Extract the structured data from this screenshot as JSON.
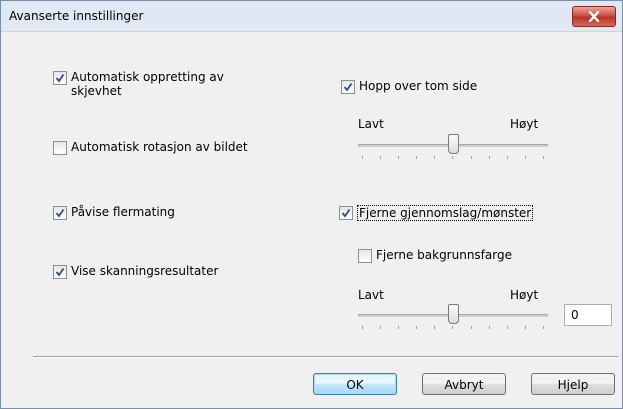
{
  "window": {
    "title": "Avanserte innstillinger"
  },
  "left": {
    "auto_deskew": {
      "label": "Automatisk oppretting av\nskjevhet",
      "line1": "Automatisk oppretting av",
      "line2": "skjevhet",
      "checked": true
    },
    "auto_rotate": {
      "label": "Automatisk rotasjon av bildet",
      "checked": false
    },
    "multifeed": {
      "label": "Påvise flermating",
      "checked": true
    },
    "show_results": {
      "label": "Vise skanningsresultater",
      "checked": true
    }
  },
  "right": {
    "skip_blank": {
      "label": "Hopp over tom side",
      "checked": true
    },
    "blank_slider": {
      "low": "Lavt",
      "high": "Høyt",
      "level": 0.5
    },
    "bleed_through": {
      "label": "Fjerne gjennomslag/mønster",
      "checked": true
    },
    "remove_bg": {
      "label": "Fjerne bakgrunnsfarge",
      "checked": false
    },
    "bg_slider": {
      "low": "Lavt",
      "high": "Høyt",
      "level": 0.5,
      "value": "0"
    }
  },
  "buttons": {
    "ok": "OK",
    "cancel": "Avbryt",
    "help": "Hjelp"
  },
  "colors": {
    "accent": "#3c7fb1",
    "close": "#c9453a"
  },
  "icons": {
    "close": "close-icon",
    "check": "checkmark-icon"
  }
}
